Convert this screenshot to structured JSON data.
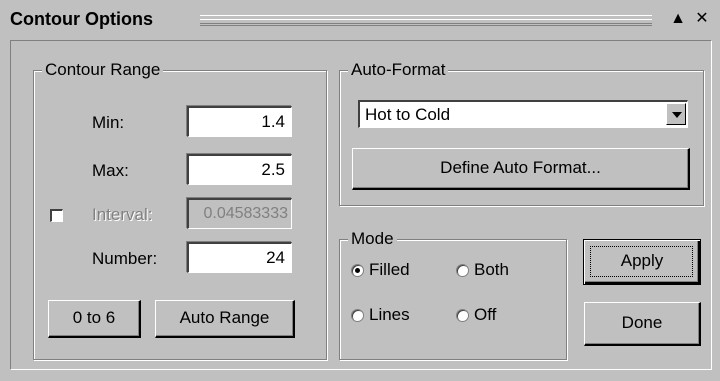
{
  "window": {
    "title": "Contour Options",
    "collapse_glyph": "▲",
    "close_glyph": "✕"
  },
  "contour_range": {
    "label": "Contour Range",
    "min_label": "Min:",
    "min_value": "1.4",
    "max_label": "Max:",
    "max_value": "2.5",
    "interval_label": "Interval:",
    "interval_value": "0.04583333",
    "interval_checked": false,
    "number_label": "Number:",
    "number_value": "24",
    "zero_to_six_label": "0 to 6",
    "auto_range_label": "Auto Range"
  },
  "auto_format": {
    "label": "Auto-Format",
    "selected": "Hot to Cold",
    "define_label": "Define Auto Format..."
  },
  "mode": {
    "label": "Mode",
    "options": [
      {
        "label": "Filled",
        "selected": true
      },
      {
        "label": "Both",
        "selected": false
      },
      {
        "label": "Lines",
        "selected": false
      },
      {
        "label": "Off",
        "selected": false
      }
    ]
  },
  "actions": {
    "apply_label": "Apply",
    "done_label": "Done"
  }
}
